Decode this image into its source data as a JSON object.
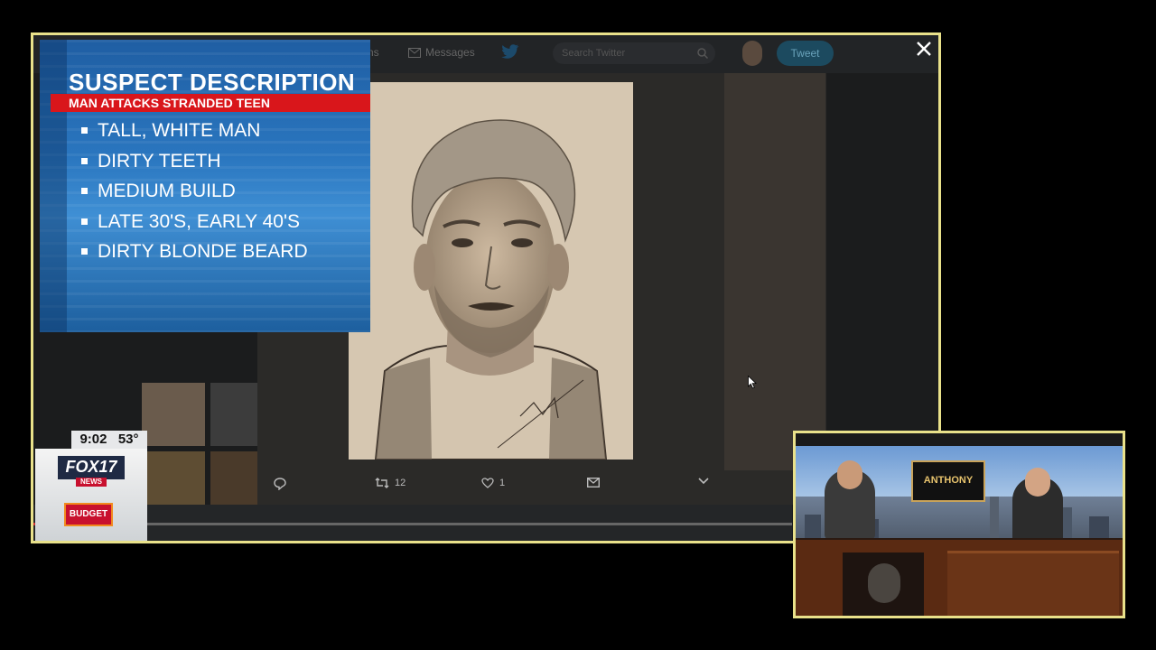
{
  "twitter_bar": {
    "nav_messages": "Messages",
    "tweet_label": "Tweet",
    "search_placeholder": "Search Twitter"
  },
  "tweet_actions": {
    "retweets": "12",
    "likes": "1"
  },
  "graphic": {
    "title": "SUSPECT DESCRIPTION",
    "subtitle": "MAN ATTACKS STRANDED TEEN",
    "items": [
      "TALL, WHITE MAN",
      "DIRTY TEETH",
      "MEDIUM BUILD",
      "LATE 30'S, EARLY 40'S",
      "DIRTY BLONDE BEARD"
    ]
  },
  "station_bug": {
    "time": "9:02",
    "temp": "53°",
    "logo": "FOX17",
    "logo_sub": "NEWS",
    "sponsor": "BUDGET"
  },
  "pip": {
    "show_logo": "ANTHONY"
  },
  "icons": {
    "close": "close-icon",
    "reply": "reply-icon",
    "retweet": "retweet-icon",
    "like": "heart-icon",
    "dm": "envelope-icon",
    "more": "chevron-down-icon",
    "twitter": "twitter-bird-icon",
    "search": "search-icon",
    "cursor": "mouse-cursor-icon"
  },
  "colors": {
    "frame_border": "#e9e18a",
    "graphic_blue": "#2a76bf",
    "graphic_red": "#d9161b",
    "twitter_blue": "#1da1f2"
  }
}
